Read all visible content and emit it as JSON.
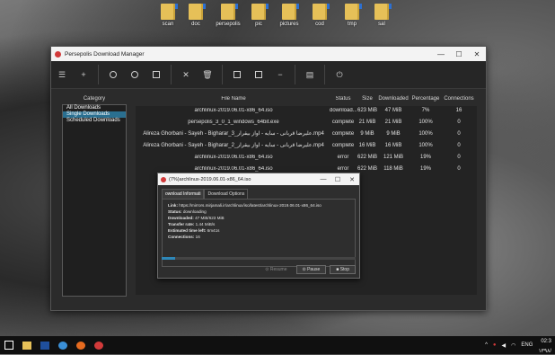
{
  "desktop_icons": [
    {
      "label": "scan"
    },
    {
      "label": "doc"
    },
    {
      "label": "persepolis"
    },
    {
      "label": "pic"
    },
    {
      "label": "pictures"
    },
    {
      "label": "cod"
    },
    {
      "label": "tmp"
    },
    {
      "label": "sal"
    }
  ],
  "window": {
    "title": "Persepolis Download Manager"
  },
  "category": {
    "header": "Category",
    "items": [
      "All Downloads",
      "Single Downloads",
      "Scheduled Downloads"
    ],
    "selected_index": 1
  },
  "table": {
    "headers": [
      "File Name",
      "Status",
      "Size",
      "Downloaded",
      "Percentage",
      "Connections"
    ],
    "rows": [
      {
        "name": "archlinux-2019.06.01-x86_64.iso",
        "status": "download...",
        "size": "623 MiB",
        "downloaded": "47 MiB",
        "percentage": "7%",
        "connections": "16"
      },
      {
        "name": "persepolis_3_0_1_windows_64bit.exe",
        "status": "complete",
        "size": "21 MiB",
        "downloaded": "21 MiB",
        "percentage": "100%",
        "connections": "0"
      },
      {
        "name": "Alireza Ghorbani - Sayeh - Bigharar_3_علیرضا قربانی - سایه - آواز بیقرار.mp4",
        "status": "complete",
        "size": "9 MiB",
        "downloaded": "9 MiB",
        "percentage": "100%",
        "connections": "0"
      },
      {
        "name": "Alireza Ghorbani - Sayeh - Bigharar_2_علیرضا قربانی - سایه - آواز بیقرار.mp4",
        "status": "complete",
        "size": "16 MiB",
        "downloaded": "16 MiB",
        "percentage": "100%",
        "connections": "0"
      },
      {
        "name": "archlinux-2019.06.01-x86_64.iso",
        "status": "error",
        "size": "622 MiB",
        "downloaded": "121 MiB",
        "percentage": "19%",
        "connections": "0"
      },
      {
        "name": "archlinux-2019.06.01-x86_64.iso",
        "status": "error",
        "size": "622 MiB",
        "downloaded": "118 MiB",
        "percentage": "19%",
        "connections": "0"
      }
    ]
  },
  "dialog": {
    "title": "(7%)archlinux-2019.06.01-x86_64.iso",
    "tabs": [
      "ownload Informati",
      "Download Options"
    ],
    "link_label": "Link:",
    "link_value": "https://mirrors.mirjamali.ir/archlinux/iso/latest/archlinux-2019.06.01-x86_64.iso",
    "status_label": "Status:",
    "status_value": "downloading",
    "downloaded_label": "Downloaded:",
    "downloaded_value": "47 MiB/623 MiB",
    "rate_label": "Transfer rate:",
    "rate_value": "1.44 MiB/s",
    "eta_label": "Estimated time left:",
    "eta_value": "6m41s",
    "connections_label": "Connections:",
    "connections_value": "16",
    "progress_percent": 7,
    "resume_label": "Resume",
    "pause_label": "Pause",
    "stop_label": "Stop"
  },
  "taskbar": {
    "lang": "ENG",
    "time": "02:3",
    "date": "۱۳۹۸/"
  }
}
